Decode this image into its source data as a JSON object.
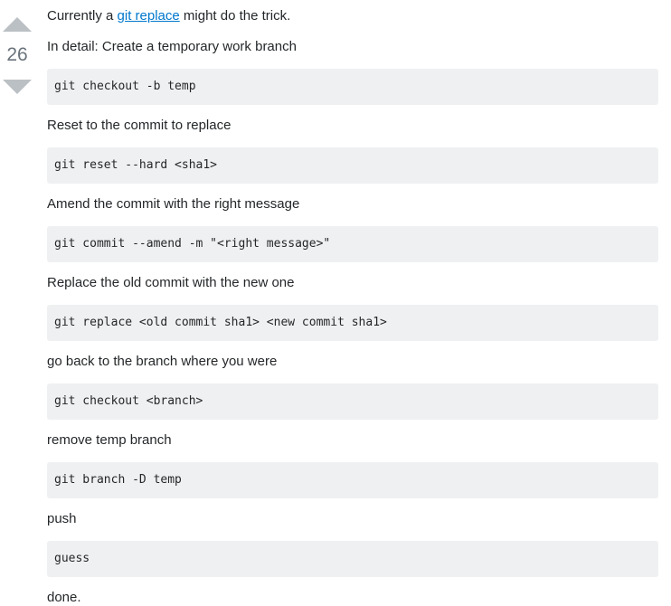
{
  "vote": {
    "score": "26"
  },
  "answer": {
    "intro_prefix": "Currently a ",
    "intro_link": "git replace",
    "intro_suffix": " might do the trick.",
    "detail": "In detail: Create a temporary work branch",
    "code_checkout_temp": "git checkout -b temp",
    "step_reset": "Reset to the commit to replace",
    "code_reset": "git reset --hard <sha1>",
    "step_amend": "Amend the commit with the right message",
    "code_amend": "git commit --amend -m \"<right message>\"",
    "step_replace": "Replace the old commit with the new one",
    "code_replace": "git replace <old commit sha1> <new commit sha1>",
    "step_back": "go back to the branch where you were",
    "code_checkout_branch": "git checkout <branch>",
    "step_remove": "remove temp branch",
    "code_branch_delete": "git branch -D temp",
    "step_push": "push",
    "code_guess": "guess",
    "step_done": "done."
  }
}
